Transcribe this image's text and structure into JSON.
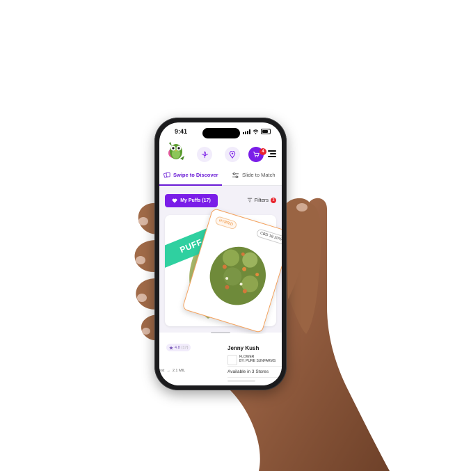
{
  "status_bar": {
    "time": "9:41"
  },
  "header": {
    "cart_count": "4"
  },
  "tabs": [
    {
      "label": "Swipe to Discover",
      "icon": "cards-icon",
      "active": true
    },
    {
      "label": "Slide to Match",
      "icon": "sliders-icon",
      "active": false
    }
  ],
  "toolbar": {
    "my_puffs_label": "My Puffs (17)",
    "filters_label": "Filters",
    "filters_count": "3"
  },
  "cards": {
    "back_overlay": "PUFF",
    "front_type_chip": "HYBRID",
    "front_cbd_chip": "CBD 16-20%"
  },
  "product": {
    "rating": "4.8",
    "rating_count": "(17)",
    "name": "Jenny Kush",
    "type": "FLOWER",
    "brand": "BY: PURE SUNFARMS",
    "availability": "Available in 3 Stores",
    "left_stat_prefix": "est",
    "left_stat_value": "2.1 MIL"
  },
  "colors": {
    "brand_purple": "#7a1de8",
    "puff_green": "#2fd0a0",
    "badge_red": "#e8232c",
    "hybrid_orange": "#f08a2c"
  }
}
